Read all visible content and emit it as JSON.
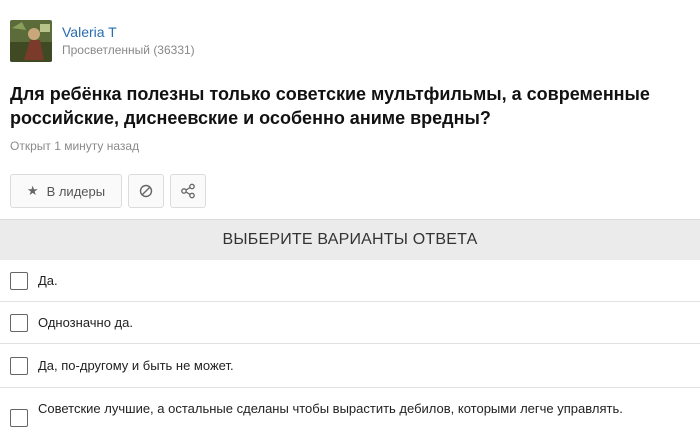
{
  "author": {
    "name": "Valeria T",
    "rank": "Просветленный (36331)",
    "avatar_icon": "avatar-image"
  },
  "question": {
    "text": "Для ребёнка полезны только советские мультфильмы, а современные российские, диснеевские и особенно аниме вредны?",
    "opened": "Открыт 1 минуту назад"
  },
  "actions": {
    "leaders_label": "В лидеры",
    "leaders_icon": "star-icon",
    "report_icon": "block-icon",
    "share_icon": "share-icon"
  },
  "poll": {
    "header": "ВЫБЕРИТЕ ВАРИАНТЫ ОТВЕТА",
    "options": [
      "Да.",
      "Однозначно да.",
      "Да, по-другому и быть не может.",
      "Советские лучшие, а остальные сделаны чтобы вырастить дебилов, которыми легче управлять."
    ]
  },
  "colors": {
    "author_link": "#2a6cb0",
    "header_bg": "#ebebeb"
  }
}
